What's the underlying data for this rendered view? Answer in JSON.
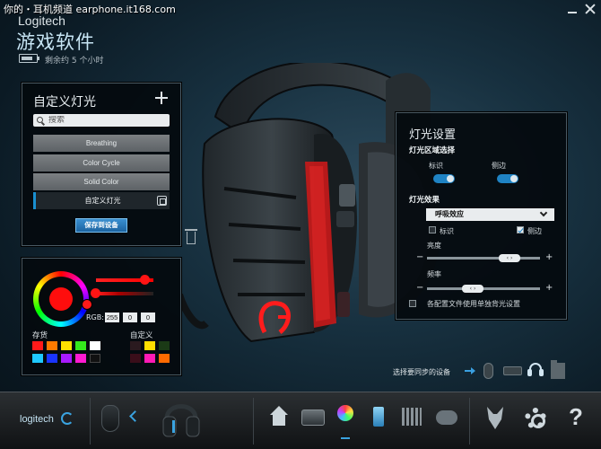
{
  "watermark": "你的・耳机频道 earphone.it168.com",
  "app": {
    "brand": "Logitech",
    "title": "游戏软件",
    "battery_text": "剩余约 5 个小时"
  },
  "custom_panel": {
    "title": "自定义灯光",
    "search_placeholder": "搜索",
    "effects": [
      "Breathing",
      "Color Cycle",
      "Solid Color",
      "自定义灯光"
    ],
    "selected_index": 3,
    "save_label": "保存到设备"
  },
  "color_panel": {
    "rgb_label": "RGB:",
    "rgb": [
      "255",
      "0",
      "0"
    ],
    "saved_label": "存货",
    "custom_label": "自定义",
    "saved_swatches": [
      "#ff1a1a",
      "#ff7a00",
      "#ffe100",
      "#34e81c",
      "#ffffff",
      "#1ec8ff",
      "#1a34ff",
      "#a81aff",
      "#ff1ad2",
      "#111111"
    ],
    "custom_swatches": [
      "#2a1a1f",
      "#ffde00",
      "#1b3a16",
      "#3a0e1a",
      "#ff1ab4",
      "#ff6a00"
    ],
    "brightness_level": 1.0
  },
  "light_panel": {
    "title": "灯光设置",
    "zone_heading": "灯光区域选择",
    "zones": [
      {
        "label": "标识",
        "on": true
      },
      {
        "label": "侧边",
        "on": true
      }
    ],
    "effect_heading": "灯光效果",
    "effect_value": "呼吸效应",
    "checkboxes": [
      {
        "label": "标识",
        "checked": false
      },
      {
        "label": "侧边",
        "checked": true
      }
    ],
    "brightness_label": "亮度",
    "rate_label": "频率",
    "brightness_level": 0.78,
    "rate_level": 0.38,
    "footer_label": "各配置文件使用单独背光设置"
  },
  "sync": {
    "label": "选择要同步的设备"
  },
  "bottom_bar": {
    "logo": "logitech",
    "help": "?"
  },
  "colors": {
    "accent": "#1f83c4",
    "red": "#ff1414"
  }
}
